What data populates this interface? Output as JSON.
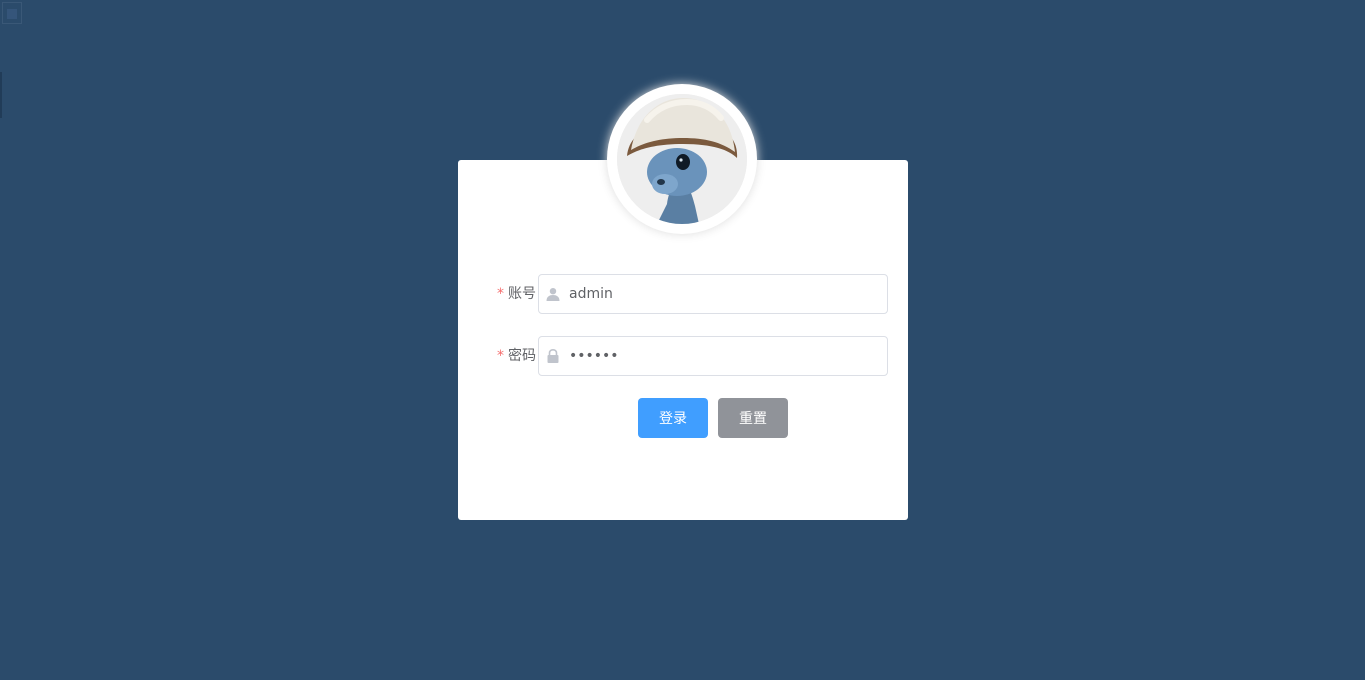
{
  "login": {
    "username": {
      "required_mark": "*",
      "label": "账号",
      "value": "admin"
    },
    "password": {
      "required_mark": "*",
      "label": "密码",
      "value": "123456"
    },
    "buttons": {
      "login_label": "登录",
      "reset_label": "重置"
    }
  },
  "icons": {
    "username_prefix": "user-icon",
    "password_prefix": "lock-icon",
    "avatar": "avatar-image"
  },
  "colors": {
    "background": "#2b4b6b",
    "primary": "#409eff",
    "info": "#909399",
    "required": "#f56c6c"
  }
}
